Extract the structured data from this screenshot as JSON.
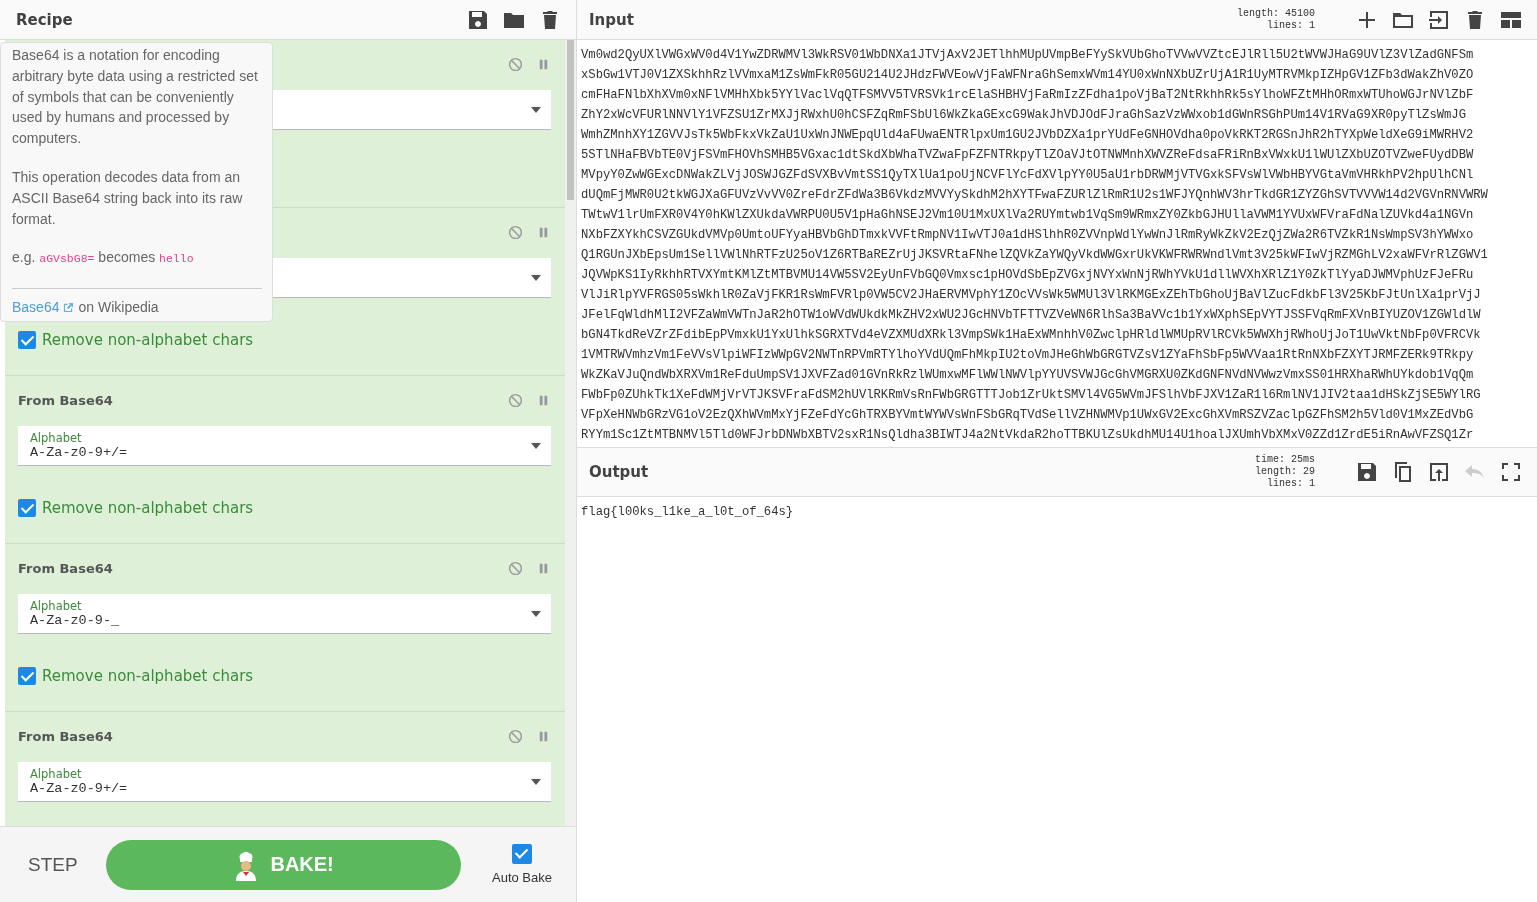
{
  "recipe": {
    "title": "Recipe",
    "operations": [
      {
        "disabled": false,
        "breakpoint": false
      },
      {
        "disabled": false,
        "breakpoint": false,
        "remove": {
          "label": "Remove non-alphabet chars",
          "checked": true
        }
      },
      {
        "name": "From Base64",
        "disabled": false,
        "breakpoint": false,
        "alphabet_label": "Alphabet",
        "alphabet": "A-Za-z0-9+/=",
        "remove": {
          "label": "Remove non-alphabet chars",
          "checked": true
        }
      },
      {
        "name": "From Base64",
        "disabled": false,
        "breakpoint": false,
        "alphabet_label": "Alphabet",
        "alphabet": "A-Za-z0-9-_",
        "remove": {
          "label": "Remove non-alphabet chars",
          "checked": true
        }
      },
      {
        "name": "From Base64",
        "disabled": false,
        "breakpoint": false,
        "alphabet_label": "Alphabet",
        "alphabet": "A-Za-z0-9+/="
      }
    ]
  },
  "tooltip": {
    "paragraphs": [
      "Base64 is a notation for encoding arbitrary byte data using a restricted set of symbols that can be conveniently used by humans and processed by computers.",
      "This operation decodes data from an ASCII Base64 string back into its raw format."
    ],
    "example_prefix": "e.g.",
    "example_input": "aGVsbG8=",
    "example_middle": "becomes",
    "example_output": "hello",
    "link": "Base64",
    "link_suffix": "on Wikipedia"
  },
  "controls": {
    "step": "STEP",
    "bake": "BAKE!",
    "auto_bake": {
      "label": "Auto Bake",
      "checked": true
    }
  },
  "input": {
    "title": "Input",
    "length_label": "length:",
    "length": "45100",
    "lines_label": "lines:",
    "lines": "1",
    "text_lines": [
      "Vm0wd2QyUXlVWGxWV0d4V1YwZDRWMVl3WkRSV01WbDNXa1JTVjAxV2JETlhhMUpUVmpBeFYySkVUbGhoTVVwVVZtcEJlRll5U2tWVWJHaG9UVlZ3VlZadGNFSm",
      "xSbGw1VTJ0V1ZXSkhhRzlVVmxaM1ZsWmFkR05GU214U2JHdzFWVEowVjFaWFNraGhSemxWVm14YU0xWnNXbUZrUjA1R1UyMTRVMkpIZHpGV1ZFb3dWakZhV0ZO",
      "cmFHaFNlbXhXVm0xNFlVMHhXbk5YYlVaclVqQTFSMVV5TVRSVk1rcElaSHBHVjFaRmIzZFdha1poVjBaT2NtRkhhRk5sYlhoWFZtMHhORmxWTUhoWGJrNVlZbF",
      "ZhY2xWcVFURlNNVlY1VFZSU1ZrMXJjRWxhU0hCSFZqRmFSbUl6WkZkaGExcG9WakJhVDJOdFJraGhSazVzWWxob1dGWnRSGhPUm14V1RVaG9XR0pyTlZsWmJG",
      "WmhZMnhXY1ZGVVJsTk5WbFkxVkZaU1UxWnJNWEpqUld4aFUwaENTRlpxUm1GU2JVbDZXa1prYUdFeGNHOVdha0poVkRKT2RGSnJhR2hTYXpWeldXeG9iMWRHV2",
      "5STlNHaFBVbTE0VjFSVmFHOVhSMHB5VGxac1dtSkdXbWhaTVZwaFpFZFNTRkpyTlZOaVJtOTNWMnhXWVZReFdsaFRiRnBxVWxkU1lWUlZXbUZOTVZweFUydDBW",
      "MVpyY0ZwWGExcDNWakZLVjJOSWJGZFdSVXBvVmtSS1QyTXlUa1poUjNCVFlYcFdXVlpYY0U5aU1rbDRWMjVTVGxkSFVsWlVWbHBYVGtaVmVHRkhPV2hpUlhCNl",
      "dUQmFjMWR0U2tkWGJXaGFUVzVvVV0ZreFdrZFdWa3B6VkdzMVVYySkdhM2hXYTFwaFZURlZlRmR1U2s1WFJYQnhWV3hrTkdGR1ZYZGhSVTVVVW14d2VGVnRNVWRW",
      "TWtwV1lrUmFXR0V4Y0hKWlZXUkdaVWRPU0U5V1pHaGhNSEJ2Vm10U1MxUXlVa2RUYmtwb1VqSm9WRmxZY0ZkbGJHUllaVWM1YVUxWFVraFdNalZUVkd4a1NGVn",
      "NXbFZXYkhCSVZGUkdVMVp0UmtoUFYyaHBVbGhDTmxkVVFtRmpNV1IwVTJ0a1dHSlhhR0ZVVnpWdlYwWnJlRmRyWkZkV2EzQjZWa2R6TVZkR1NsWmpSV3hYWWxo",
      "Q1RGUnJXbEpsUm1SellVWlNhRTFzU25oV1Z6RTBaREZrUjJKSVRtaFNhelZQVkZaYWQyVkdWWGxrUkVKWFRWRWndlVmt3V25kWFIwVjRZMGhLV2xaWFVrRlZGWV1",
      "JQVWpKS1IyRkhhRTVXYmtKMlZtMTBVMU14VW5SV2EyUnFVbGQ0Vmxsc1pHOVdSbEpZVGxjNVYxWnNjRWhYVkU1dllWVXhXRlZ1Y0ZkTlYyaDJWMVphUzFJeFRu",
      "VlJiRlpYVFRGS05sWkhlR0ZaVjFKR1RsWmFVRlp0VW5CV2JHaERVMVphY1ZOcVVsWk5WMUl3VlRKMGExZEhTbGhoUjBaVlZucFdkbFl3V25KbFJtUnlXa1prVjJ",
      "JFelFqWldhMlI2VFZaWmVWTnJaR2hOTW1oWVdWUkdkMkZHV2xWU2JGcHNVbTFTTVZVeWN6RlhSa3BaVVc1b1YxWXphSEpVYTJSSFVqRmFXVnBIYUZOV1ZGWldlW",
      "bGN4TkdReVZrZFdibEpPVmxkU1YxUlhkSGRXTVd4eVZXMUdXRkl3VmpSWk1HaExWMnhhV0ZwclpHRldlWMUpRVlRCVk5WWXhjRWhoUjJoT1UwVktNbFp0VFRCVk",
      "1VMTRWVmhzVm1FeVVsVlpiWFIzWWpGV2NWTnRPVmRTYlhoYVdUQmFhMkpIU2toVmJHeGhWbGRGTVZsV1ZYaFhSbFp5WVVaa1RtRnNXbFZXYTJRMFZERk9TRkpy",
      "WkZKaVJuQndWbXRXVm1ReFduUmpSV1JXVFZad01GVnRkRzlWUmxwMFlWWlNWVlpYYUVSVWJGcGhVMGRXU0ZKdGNFNVdNVWwzVmxSS01HRXhaRWhUYkdob1VqQm",
      "FWbFp0ZUhkTk1XeFdWMjVrVTJKSVFraFdSM2hUVlRKRmVsRnFWbGRGTTTJob1ZrUktSMVl4VG5WVmJFSlhVbFJXV1ZaR1l6RmlNV1JIV2taa1dHSkZjSE5WYlRG",
      "VFpXeHNWbGRzVG1oV2EzQXhWVmMxYjFZeFdYcGhTRXBYVmtWYWVsWnFSbGRqTVdSellVZHNWMVp1UWxGV2ExcGhXVmRSZVZaclpGZFhSM2h5Vld0V1MxZEdVbG",
      "RYYm1Sc1ZtMTBNMVl5Tld0WFJrbDNWbXBTV2sxR1NsQldha3BIWTJ4a2NtVkdaR2hoTTBKUlZsUkdhMU14U1hoalJXUmhVbXMxV0ZZd1ZrdE5iRnAwVFZSQ1Zr"
    ]
  },
  "output": {
    "title": "Output",
    "time_label": "time:",
    "time": "25ms",
    "length_label": "length:",
    "length": "29",
    "lines_label": "lines:",
    "lines": "1",
    "undo_disabled": true,
    "text": "flag{l00ks_l1ke_a_l0t_of_64s}"
  }
}
